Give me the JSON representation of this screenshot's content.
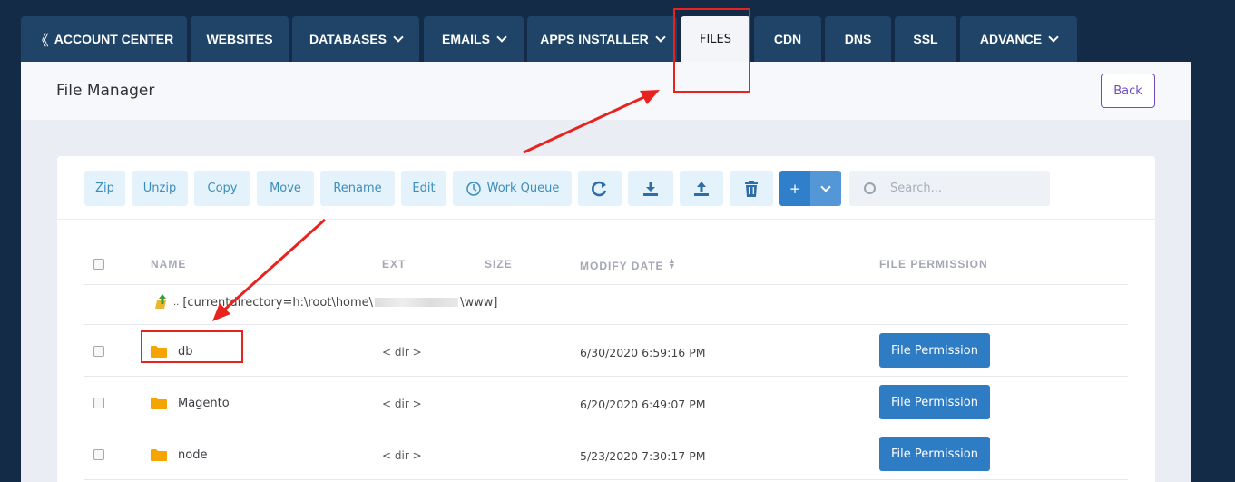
{
  "tabs": [
    {
      "label": "ACCOUNT CENTER",
      "prefix": "《",
      "dropdown": false
    },
    {
      "label": "WEBSITES",
      "dropdown": false
    },
    {
      "label": "DATABASES",
      "dropdown": true
    },
    {
      "label": "EMAILS",
      "dropdown": true
    },
    {
      "label": "APPS INSTALLER",
      "dropdown": true
    },
    {
      "label": "FILES",
      "dropdown": false,
      "active": true
    },
    {
      "label": "CDN",
      "dropdown": false
    },
    {
      "label": "DNS",
      "dropdown": false
    },
    {
      "label": "SSL",
      "dropdown": false
    },
    {
      "label": "ADVANCE",
      "dropdown": true
    }
  ],
  "header": {
    "title": "File Manager",
    "back_label": "Back"
  },
  "toolbar": {
    "zip": "Zip",
    "unzip": "Unzip",
    "copy": "Copy",
    "move": "Move",
    "rename": "Rename",
    "edit": "Edit",
    "work_queue": "Work Queue",
    "new_label": "+",
    "search_placeholder": "Search..."
  },
  "table": {
    "columns": {
      "name": "NAME",
      "ext": "EXT",
      "size": "SIZE",
      "date": "MODIFY DATE",
      "perm": "FILE PERMISSION"
    },
    "parent": {
      "prefix": "..",
      "path_start": "[currentdirectory=h:\\root\\home\\",
      "path_end": "\\www]"
    },
    "rows": [
      {
        "name": "db",
        "ext": "< dir >",
        "date": "6/30/2020 6:59:16 PM",
        "perm_label": "File Permission"
      },
      {
        "name": "Magento",
        "ext": "< dir >",
        "date": "6/20/2020 6:49:07 PM",
        "perm_label": "File Permission"
      },
      {
        "name": "node",
        "ext": "< dir >",
        "date": "5/23/2020 7:30:17 PM",
        "perm_label": "File Permission"
      }
    ]
  },
  "colors": {
    "background": "#132b47",
    "tab": "#1f4468",
    "primary": "#2e7cc4",
    "annotation": "#e8231f",
    "folder": "#f6a400"
  }
}
